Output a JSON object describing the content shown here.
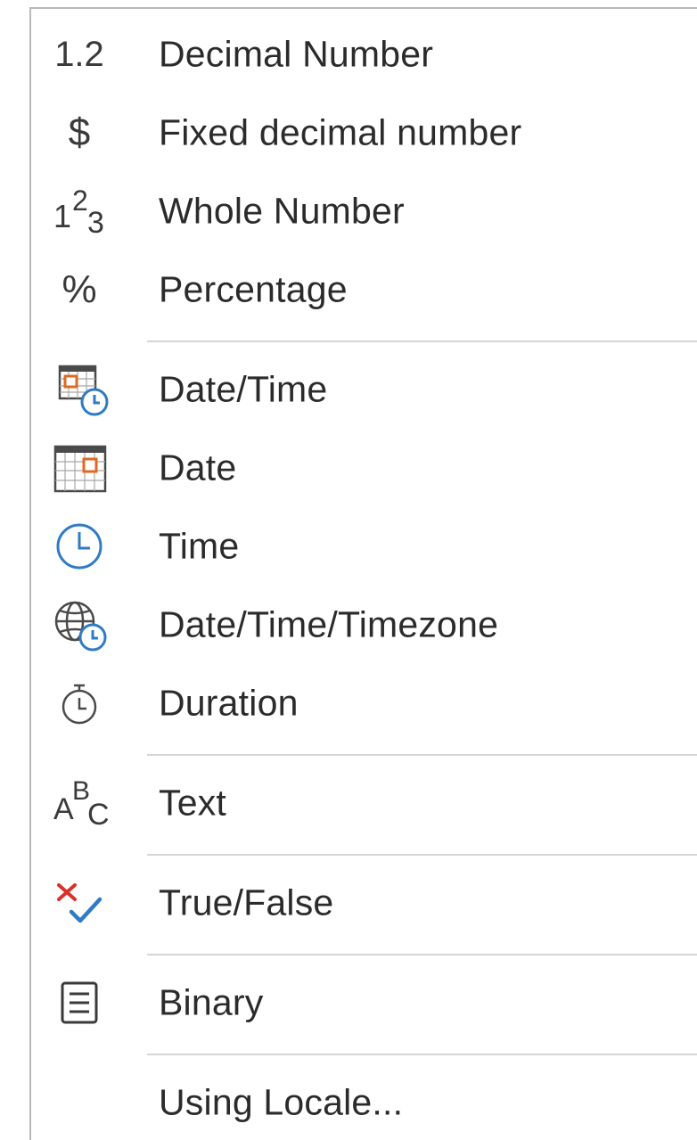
{
  "menu": {
    "items": [
      {
        "label": "Decimal Number",
        "icon": "decimal-number-icon",
        "icon_text": "1.2"
      },
      {
        "label": "Fixed decimal number",
        "icon": "dollar-icon",
        "icon_text": "$"
      },
      {
        "label": "Whole Number",
        "icon": "whole-number-icon",
        "icon_text": [
          "1",
          "2",
          "3"
        ]
      },
      {
        "label": "Percentage",
        "icon": "percent-icon",
        "icon_text": "%"
      },
      {
        "label": "Date/Time",
        "icon": "calendar-clock-icon"
      },
      {
        "label": "Date",
        "icon": "calendar-icon"
      },
      {
        "label": "Time",
        "icon": "clock-icon"
      },
      {
        "label": "Date/Time/Timezone",
        "icon": "globe-clock-icon"
      },
      {
        "label": "Duration",
        "icon": "stopwatch-icon"
      },
      {
        "label": "Text",
        "icon": "text-abc-icon",
        "icon_text": [
          "A",
          "B",
          "C"
        ]
      },
      {
        "label": "True/False",
        "icon": "true-false-icon"
      },
      {
        "label": "Binary",
        "icon": "binary-document-icon"
      },
      {
        "label": "Using Locale...",
        "icon": ""
      }
    ]
  },
  "colors": {
    "icon_gray": "#3a3a3a",
    "accent_blue": "#2f7bc4",
    "accent_orange": "#e06a24",
    "accent_red": "#d8322a",
    "separator": "#d6d6d6"
  }
}
